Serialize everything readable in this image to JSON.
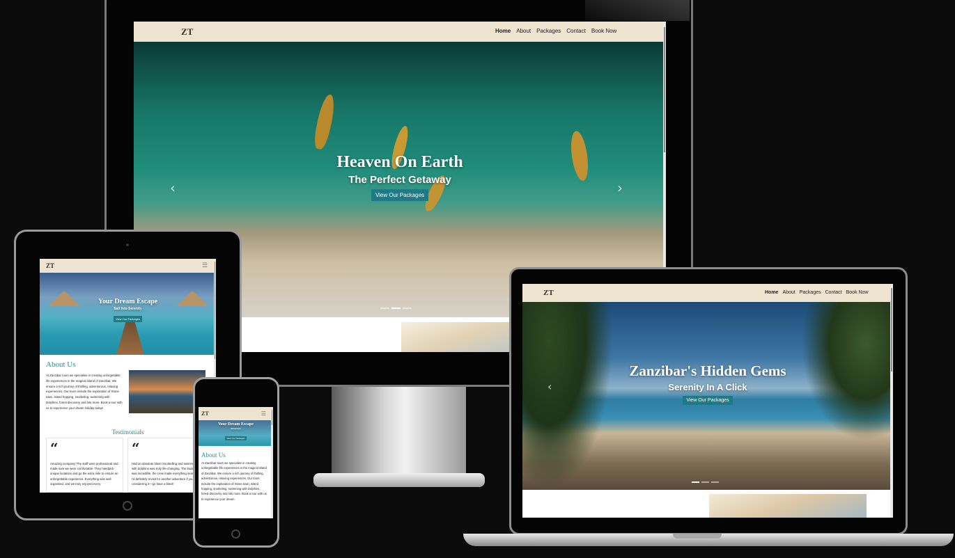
{
  "logo": "ZT",
  "nav": {
    "home": "Home",
    "about": "About",
    "packages": "Packages",
    "contact": "Contact",
    "book": "Book Now"
  },
  "slides": {
    "desktop": {
      "title": "Heaven On Earth",
      "subtitle": "The Perfect Getaway",
      "cta": "View Our Packages"
    },
    "laptop": {
      "title": "Zanzibar's Hidden Gems",
      "subtitle": "Serenity In A Click",
      "cta": "View Our Packages"
    },
    "tablet": {
      "title": "Your Dream Escape",
      "subtitle": "Sail Into Serenity",
      "cta": "View Our Packages"
    },
    "phone": {
      "title": "Your Dream Escape",
      "subtitle": "Adventure",
      "cta": "View Our Packages"
    }
  },
  "about": {
    "title": "About Us",
    "text_tablet": "At Zanzibar tours we specialise in creating unforgettable life experiences in the magical island of Zanzibar. We ensure a rich journey of thrilling, adventurous, relaxing experiences. Our tours include the exploration of Stone town, island hopping, snorkeling, swimming with Dolphins, forest discovery and lots more. Book a tour with us to experience your dream holiday today!",
    "text_phone": "At Zanzibar tours we specialise in creating unforgettable life experiences in the magical island of Zanzibar. We ensure a rich journey of thrilling, adventurous, relaxing experiences. Our tours include the exploration of Stone town, island hopping, snorkeling, swimming with Dolphins, forest discovery and lots more. Book a tour with us to experience your dream"
  },
  "testimonials": {
    "title": "Testimonials",
    "quote_mark": "“",
    "items": [
      {
        "text": "Amazing company! The staff were professional and made sure we were comfortable. They handpick unique locations and go the extra mile to ensure an unforgettable experience. Everything was well organised, and we truly enjoyed every"
      },
      {
        "text": "Had an absolute blast! Snorkelling and swimming with dolphins was truly life-changing. The boat ride was incredible, the crew made everything seamless. I'd definitely revisit for another adventure if you are considering it—go have a blast!"
      }
    ]
  },
  "icons": {
    "prev": "‹",
    "next": "›",
    "menu": "☰"
  },
  "colors": {
    "nav": "#efe4cf",
    "accent": "#1e7b86",
    "heading": "#2f8a8c"
  }
}
